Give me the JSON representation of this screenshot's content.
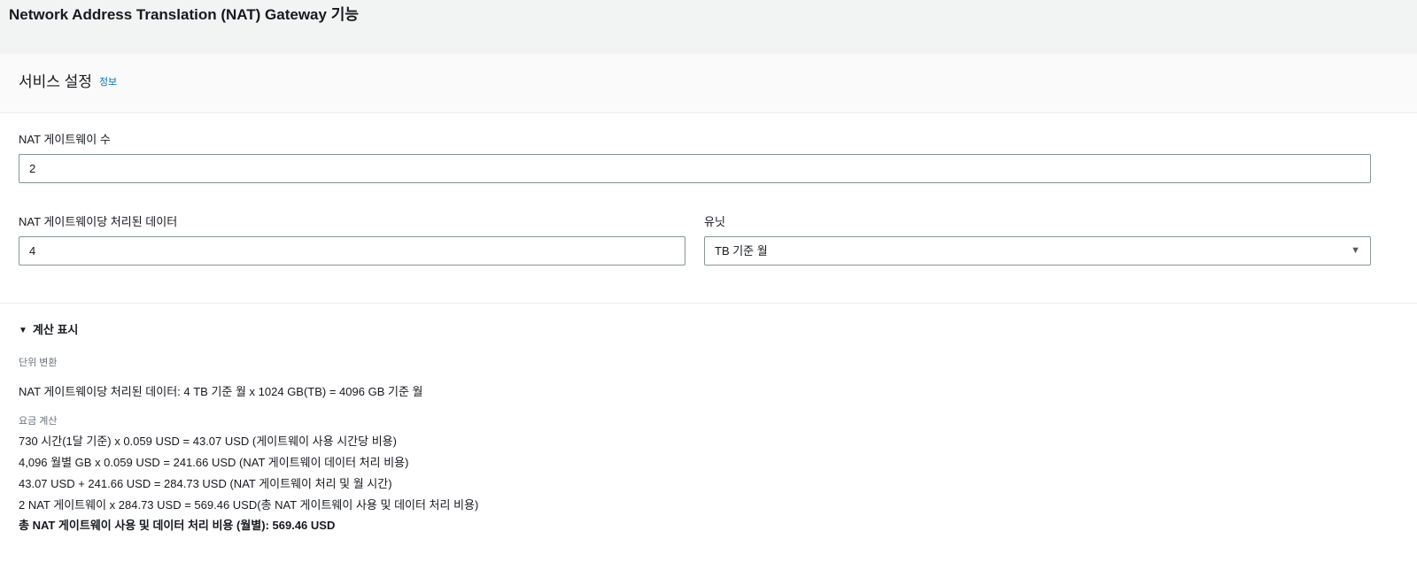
{
  "page": {
    "title": "Network Address Translation (NAT) Gateway 기능"
  },
  "section": {
    "title": "서비스 설정",
    "info_link": "정보"
  },
  "fields": {
    "gateway_count": {
      "label": "NAT 게이트웨이 수",
      "value": "2"
    },
    "data_processed": {
      "label": "NAT 게이트웨이당 처리된 데이터",
      "value": "4"
    },
    "unit": {
      "label": "유닛",
      "selected": "TB 기준 월"
    }
  },
  "calculation": {
    "toggle_label": "계산 표시",
    "unit_conversion_label": "단위 변환",
    "unit_conversion_line": "NAT 게이트웨이당 처리된 데이터: 4 TB 기준 월 x 1024 GB(TB) = 4096 GB 기준 월",
    "pricing_label": "요금 계산",
    "lines": [
      "730 시간(1달 기준) x 0.059 USD = 43.07 USD (게이트웨이 사용 시간당 비용)",
      "4,096 월별 GB x 0.059 USD = 241.66 USD (NAT 게이트웨이 데이터 처리 비용)",
      "43.07 USD + 241.66 USD = 284.73 USD (NAT 게이트웨이 처리 및 월 시간)",
      "2 NAT 게이트웨이 x 284.73 USD = 569.46 USD(총 NAT 게이트웨이 사용 및 데이터 처리 비용)"
    ],
    "total_line": "총 NAT 게이트웨이 사용 및 데이터 처리 비용 (월별): 569.46 USD"
  }
}
